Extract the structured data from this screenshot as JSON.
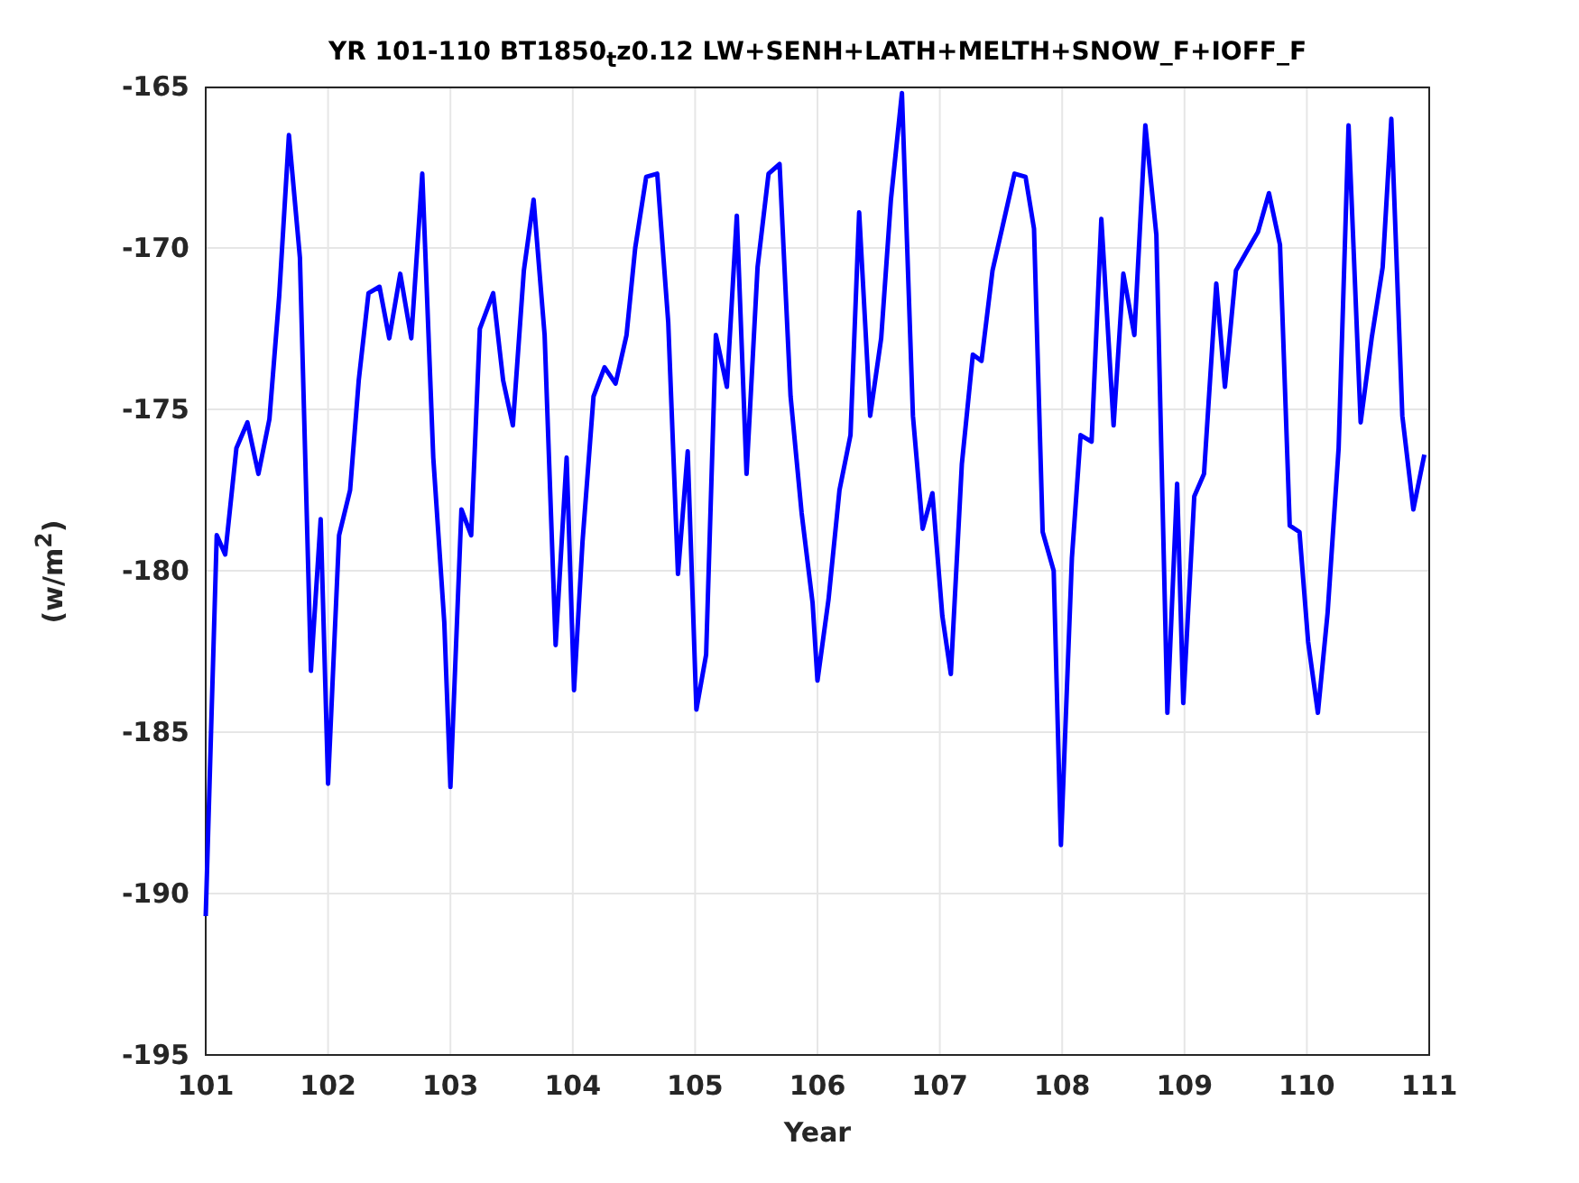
{
  "figure": {
    "chart_data": {
      "type": "line",
      "grid": true,
      "title": "YR 101-110 BT1850$_{t}$z0.12 LW+SENH+LATH+MELTH+SNOW_F+IOFF_F",
      "xlabel": "Year",
      "ylabel": "(w/m$^{2}$)",
      "xlim": [
        101,
        111
      ],
      "ylim": [
        -195,
        -165
      ],
      "xticks": [
        101,
        102,
        103,
        104,
        105,
        106,
        107,
        108,
        109,
        110,
        111
      ],
      "yticks": [
        -195,
        -190,
        -185,
        -180,
        -175,
        -170,
        -165
      ],
      "x": [
        101.0,
        101.09,
        101.16,
        101.25,
        101.34,
        101.43,
        101.52,
        101.6,
        101.68,
        101.77,
        101.86,
        101.94,
        102.0,
        102.09,
        102.18,
        102.25,
        102.33,
        102.42,
        102.5,
        102.59,
        102.68,
        102.77,
        102.86,
        102.95,
        103.0,
        103.09,
        103.17,
        103.24,
        103.35,
        103.43,
        103.51,
        103.6,
        103.68,
        103.77,
        103.86,
        103.95,
        104.01,
        104.08,
        104.17,
        104.26,
        104.35,
        104.44,
        104.51,
        104.6,
        104.69,
        104.78,
        104.86,
        104.94,
        105.01,
        105.09,
        105.17,
        105.26,
        105.34,
        105.42,
        105.51,
        105.6,
        105.69,
        105.78,
        105.87,
        105.96,
        106.0,
        106.09,
        106.18,
        106.27,
        106.34,
        106.43,
        106.52,
        106.6,
        106.69,
        106.78,
        106.86,
        106.94,
        107.02,
        107.09,
        107.18,
        107.27,
        107.34,
        107.43,
        107.52,
        107.61,
        107.7,
        107.77,
        107.84,
        107.93,
        107.99,
        108.08,
        108.15,
        108.24,
        108.32,
        108.42,
        108.5,
        108.59,
        108.68,
        108.77,
        108.86,
        108.94,
        108.99,
        109.08,
        109.16,
        109.26,
        109.33,
        109.42,
        109.51,
        109.6,
        109.69,
        109.78,
        109.86,
        109.94,
        110.01,
        110.09,
        110.17,
        110.26,
        110.34,
        110.44,
        110.53,
        110.62,
        110.69,
        110.78,
        110.87,
        110.96
      ],
      "series": [
        {
          "color": "#0000ff",
          "values": [
            -190.7,
            -178.9,
            -179.5,
            -176.2,
            -175.4,
            -177.0,
            -175.3,
            -171.5,
            -166.5,
            -170.3,
            -183.1,
            -178.4,
            -186.6,
            -178.9,
            -177.5,
            -174.1,
            -171.4,
            -171.2,
            -172.8,
            -170.8,
            -172.8,
            -167.7,
            -176.5,
            -181.6,
            -186.7,
            -178.1,
            -178.9,
            -172.5,
            -171.4,
            -174.1,
            -175.5,
            -170.7,
            -168.5,
            -172.7,
            -182.3,
            -176.5,
            -183.7,
            -179.1,
            -174.6,
            -173.7,
            -174.2,
            -172.7,
            -170.0,
            -167.8,
            -167.7,
            -172.3,
            -180.1,
            -176.3,
            -184.3,
            -182.6,
            -172.7,
            -174.3,
            -169.0,
            -177.0,
            -170.6,
            -167.7,
            -167.4,
            -174.6,
            -178.2,
            -181.0,
            -183.4,
            -180.9,
            -177.5,
            -175.8,
            -168.9,
            -175.2,
            -172.8,
            -168.5,
            -165.2,
            -175.2,
            -178.7,
            -177.6,
            -181.4,
            -183.2,
            -176.7,
            -173.3,
            -173.5,
            -170.7,
            -169.2,
            -167.7,
            -167.8,
            -169.4,
            -178.8,
            -180.0,
            -188.5,
            -179.6,
            -175.8,
            -176.0,
            -169.1,
            -175.5,
            -170.8,
            -172.7,
            -166.2,
            -169.6,
            -184.4,
            -177.3,
            -184.1,
            -177.7,
            -177.0,
            -171.1,
            -174.3,
            -170.7,
            -170.1,
            -169.5,
            -168.3,
            -169.9,
            -178.6,
            -178.8,
            -182.2,
            -184.4,
            -181.3,
            -176.2,
            -166.2,
            -175.4,
            -172.8,
            -170.6,
            -166.0,
            -175.2,
            -178.1,
            -176.4
          ]
        }
      ]
    }
  }
}
